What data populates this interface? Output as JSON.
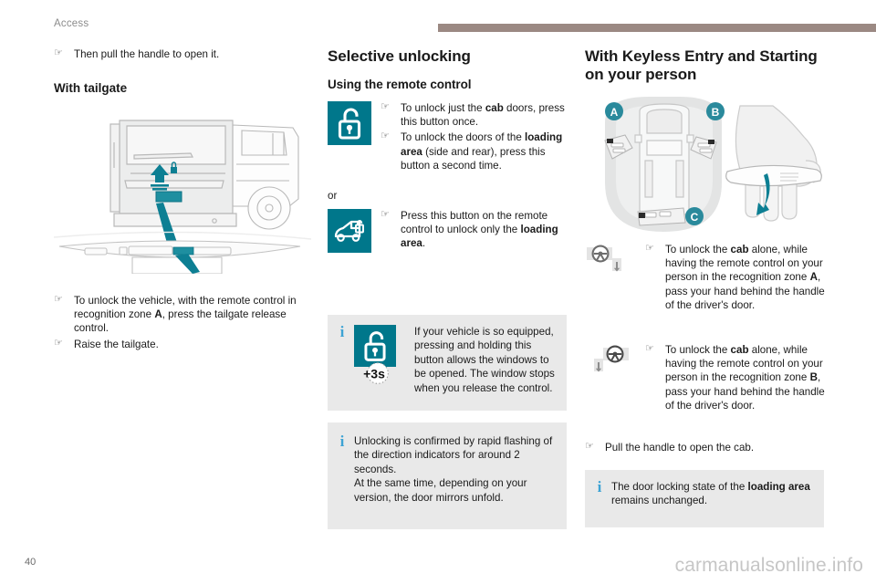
{
  "header": {
    "chapter": "Access",
    "rule_color": "#9b8983"
  },
  "colors": {
    "teal": "#00778b",
    "info_blue": "#3da3d4",
    "info_bg": "#e9e9e9"
  },
  "left_column": {
    "intro_bullet": "Then pull the handle to open it.",
    "heading": "With tailgate",
    "illustration_name": "rear-tailgate-illustration",
    "bullets": [
      {
        "parts": [
          {
            "t": "To unlock the vehicle, with the remote control in recognition zone ",
            "b": false
          },
          {
            "t": "A",
            "b": true
          },
          {
            "t": ", press the tailgate release control.",
            "b": false
          }
        ]
      },
      {
        "parts": [
          {
            "t": "Raise the tailgate.",
            "b": false
          }
        ]
      }
    ]
  },
  "middle_column": {
    "heading": "Selective unlocking",
    "subheading": "Using the remote control",
    "icon1_name": "open-padlock-icon",
    "icon1_bullets": [
      {
        "parts": [
          {
            "t": "To unlock just the ",
            "b": false
          },
          {
            "t": "cab",
            "b": true
          },
          {
            "t": " doors, press this button once.",
            "b": false
          }
        ]
      },
      {
        "parts": [
          {
            "t": "To unlock the doors of the ",
            "b": false
          },
          {
            "t": "loading area",
            "b": true
          },
          {
            "t": " (side and rear), press this button a second time.",
            "b": false
          }
        ]
      }
    ],
    "or_label": "or",
    "icon2_name": "car-loading-area-unlock-icon",
    "icon2_bullets": [
      {
        "parts": [
          {
            "t": "Press this button on the remote control to unlock only the ",
            "b": false
          },
          {
            "t": "loading area",
            "b": true
          },
          {
            "t": ".",
            "b": false
          }
        ]
      }
    ],
    "info1": {
      "icon_name": "open-padlock-icon",
      "badge": "+3s",
      "text_parts": [
        {
          "t": "If your vehicle is so equipped, pressing and holding this button allows the windows to be opened. The window stops when you release the control.",
          "b": false
        }
      ]
    },
    "info2": {
      "text_parts": [
        {
          "t": "Unlocking is confirmed by rapid flashing of the direction indicators for around 2 seconds.",
          "b": false
        },
        {
          "t": "BR",
          "b": false
        },
        {
          "t": "At the same time, depending on your version, the door mirrors unfold.",
          "b": false
        }
      ],
      "line1": "Unlocking is confirmed by rapid flashing of the direction indicators for around 2 seconds.",
      "line2": "At the same time, depending on your version, the door mirrors unfold."
    }
  },
  "right_column": {
    "heading": "With Keyless Entry and Starting on your person",
    "illustration_name": "recognition-zones-and-hand-illustration",
    "zone_labels": [
      "A",
      "B",
      "C"
    ],
    "bullets": [
      {
        "icon_name": "steering-wheel-left-door-icon",
        "parts": [
          {
            "t": "To unlock the ",
            "b": false
          },
          {
            "t": "cab",
            "b": true
          },
          {
            "t": " alone, while having the remote control on your person in the recognition zone ",
            "b": false
          },
          {
            "t": "A",
            "b": true
          },
          {
            "t": ", pass your hand behind the handle of the driver's door.",
            "b": false
          }
        ]
      },
      {
        "icon_name": "steering-wheel-right-door-icon",
        "parts": [
          {
            "t": "To unlock the ",
            "b": false
          },
          {
            "t": "cab",
            "b": true
          },
          {
            "t": " alone, while having the remote control on your person in the recognition zone ",
            "b": false
          },
          {
            "t": "B",
            "b": true
          },
          {
            "t": ", pass your hand behind the handle of the driver's door.",
            "b": false
          }
        ]
      }
    ],
    "final_bullet": {
      "parts": [
        {
          "t": "Pull the handle to open the cab.",
          "b": false
        }
      ]
    },
    "info": {
      "text_parts": [
        {
          "t": "The door locking state of the ",
          "b": false
        },
        {
          "t": "loading area",
          "b": true
        },
        {
          "t": " remains unchanged.",
          "b": false
        }
      ]
    }
  },
  "footer": {
    "page_number": "40",
    "watermark": "carmanualsonline.info"
  }
}
